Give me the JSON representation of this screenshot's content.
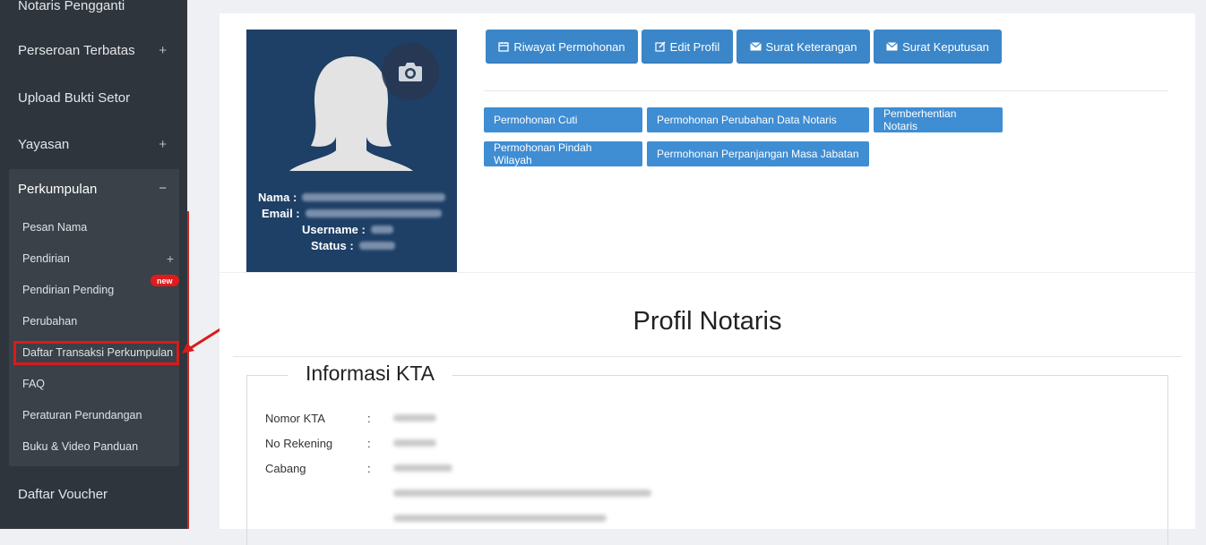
{
  "sidebar": {
    "top_item": "Notaris Pengganti",
    "items": [
      {
        "label": "Perseroan Terbatas",
        "has_plus": true
      },
      {
        "label": "Upload Bukti Setor",
        "has_plus": false
      },
      {
        "label": "Yayasan",
        "has_plus": true
      }
    ],
    "group": {
      "title": "Perkumpulan",
      "children": [
        {
          "label": "Pesan Nama"
        },
        {
          "label": "Pendirian"
        },
        {
          "label": "Pendirian Pending"
        },
        {
          "label": "Perubahan"
        },
        {
          "label": "Daftar Transaksi Perkumpulan"
        },
        {
          "label": "FAQ"
        },
        {
          "label": "Peraturan Perundangan"
        },
        {
          "label": "Buku & Video Panduan"
        }
      ],
      "badge": "new"
    },
    "bottom_item": "Daftar Voucher"
  },
  "profile": {
    "nama_label": "Nama :",
    "email_label": "Email :",
    "username_label": "Username :",
    "status_label": "Status :"
  },
  "actions": {
    "riwayat": "Riwayat Permohonan",
    "edit": "Edit Profil",
    "surat_keterangan": "Surat Keterangan",
    "surat_keputusan": "Surat Keputusan"
  },
  "requests": {
    "cuti": "Permohonan Cuti",
    "perubahan_data": "Permohonan Perubahan Data Notaris",
    "pemberhentian": "Pemberhentian Notaris",
    "pindah_wilayah": "Permohonan Pindah Wilayah",
    "perpanjangan": "Permohonan Perpanjangan Masa Jabatan"
  },
  "main": {
    "title": "Profil Notaris",
    "section": "Informasi KTA",
    "fields": [
      {
        "label": "Nomor KTA"
      },
      {
        "label": "No Rekening"
      },
      {
        "label": "Cabang"
      }
    ],
    "colon": ":"
  }
}
